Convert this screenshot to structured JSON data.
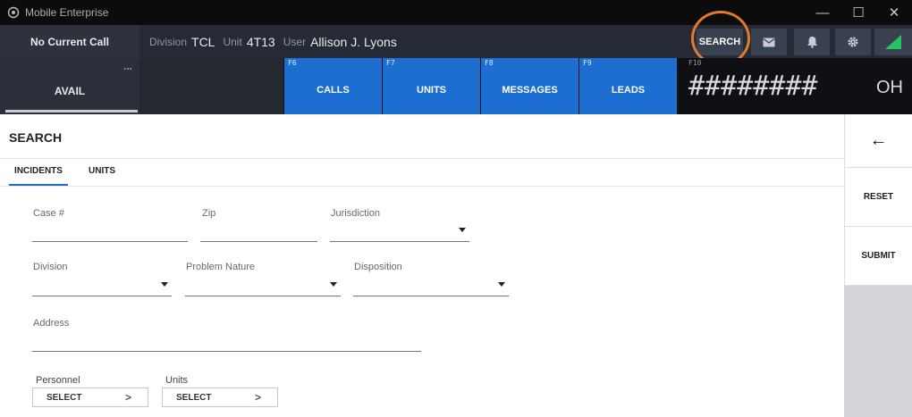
{
  "window": {
    "title": "Mobile Enterprise",
    "minimize_glyph": "—",
    "maximize_glyph": "☐",
    "close_glyph": "✕"
  },
  "infobar": {
    "call_status": "No Current Call",
    "division_label": "Division",
    "division_value": "TCL",
    "unit_label": "Unit",
    "unit_value": "4T13",
    "user_label": "User",
    "user_value": "Allison J. Lyons",
    "search_label": "SEARCH",
    "icons": [
      "mail-icon",
      "bell-icon",
      "gear-icon",
      "signal-icon"
    ]
  },
  "fkeys": {
    "status_label": "AVAIL",
    "status_menu_glyph": "...",
    "buttons": [
      {
        "key": "F6",
        "label": "CALLS"
      },
      {
        "key": "F7",
        "label": "UNITS"
      },
      {
        "key": "F8",
        "label": "MESSAGES"
      },
      {
        "key": "F9",
        "label": "LEADS"
      }
    ],
    "f10_key": "F10",
    "f10_value": "########",
    "oh_label": "OH"
  },
  "page": {
    "title": "SEARCH",
    "tabs": [
      {
        "label": "INCIDENTS",
        "active": true
      },
      {
        "label": "UNITS",
        "active": false
      }
    ]
  },
  "form": {
    "case_label": "Case #",
    "zip_label": "Zip",
    "jurisdiction_label": "Jurisdiction",
    "division_label": "Division",
    "problem_nature_label": "Problem Nature",
    "disposition_label": "Disposition",
    "address_label": "Address",
    "personnel_label": "Personnel",
    "units_label": "Units",
    "select_label": "SELECT",
    "chevron_glyph": ">"
  },
  "side": {
    "back_glyph": "←",
    "reset_label": "RESET",
    "submit_label": "SUBMIT"
  },
  "colors": {
    "accent": "#1c6fd1",
    "highlight_ring": "#e07b2e",
    "signal": "#22c55e"
  }
}
